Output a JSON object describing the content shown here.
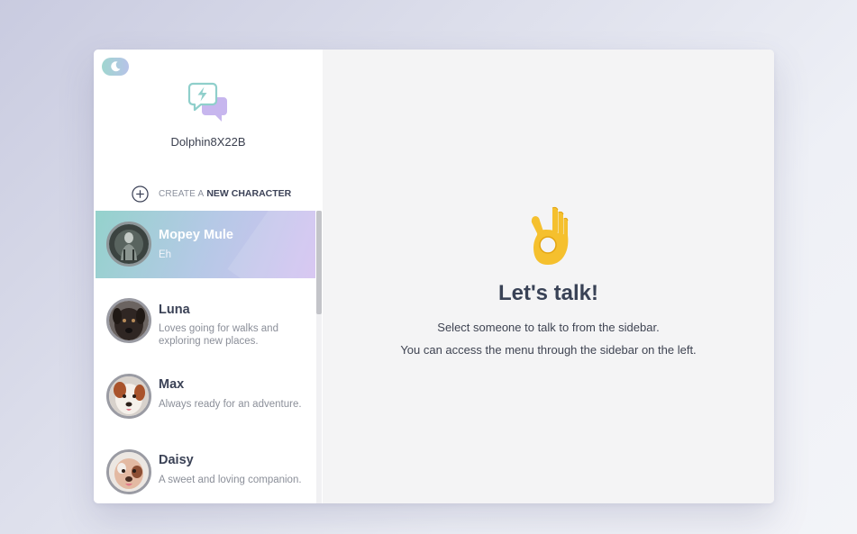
{
  "sidebar": {
    "theme_toggle": {
      "icon": "moon-icon"
    },
    "logo": {
      "icon": "chat-bubbles-bolt-icon"
    },
    "username": "Dolphin8X22B",
    "create": {
      "prefix": "CREATE A",
      "label": "NEW CHARACTER",
      "icon": "plus-circle-icon"
    },
    "characters": [
      {
        "name": "Mopey Mule",
        "description": "Eh",
        "active": true,
        "avatar": "mopey-mule-avatar"
      },
      {
        "name": "Luna",
        "description": "Loves going for walks and exploring new places.",
        "active": false,
        "avatar": "luna-avatar"
      },
      {
        "name": "Max",
        "description": "Always ready for an adventure.",
        "active": false,
        "avatar": "max-avatar"
      },
      {
        "name": "Daisy",
        "description": "A sweet and loving companion.",
        "active": false,
        "avatar": "daisy-avatar"
      }
    ]
  },
  "main": {
    "icon": "ok-hand-icon",
    "title": "Let's talk!",
    "line1": "Select someone to talk to from the sidebar.",
    "line2": "You can access the menu through the sidebar on the left."
  },
  "colors": {
    "accent_teal": "#94d2cc",
    "accent_lavender": "#d4c1f1",
    "text_dark": "#394256",
    "text_muted": "#8b8f99",
    "emoji_yellow": "#f5c02e"
  }
}
